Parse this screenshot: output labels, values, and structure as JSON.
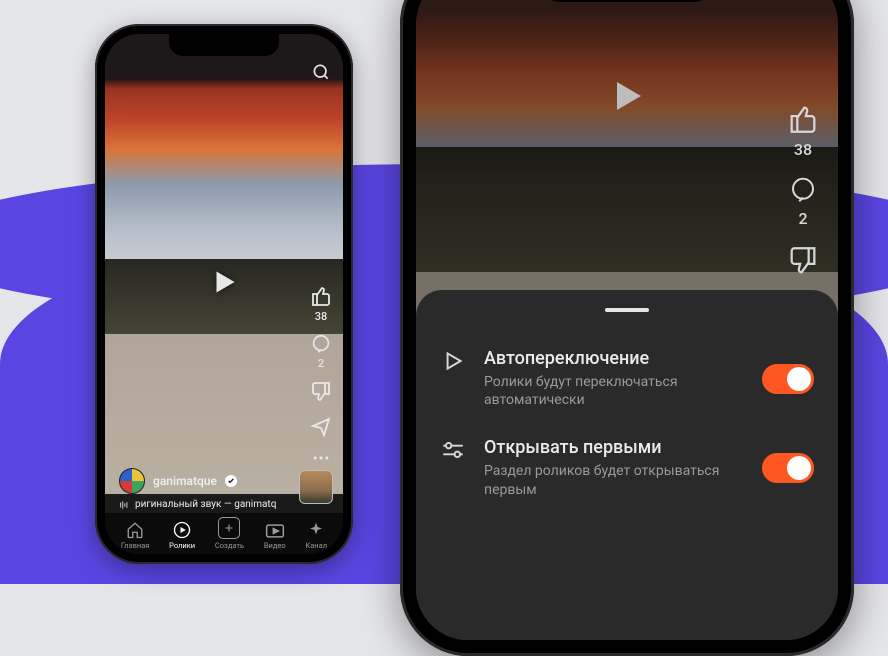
{
  "phone1": {
    "author_name": "ganimatque",
    "audio_text": "ригинальный звук — ganimatq",
    "likes": "38",
    "comments": "2",
    "tabs": {
      "home": "Главная",
      "clips": "Ролики",
      "create": "Создать",
      "video": "Видео",
      "channel": "Канал"
    }
  },
  "phone2": {
    "likes": "38",
    "comments": "2",
    "settings": {
      "autoplay": {
        "title": "Автопереключение",
        "desc": "Ролики будут переключаться автоматически",
        "on": true
      },
      "open_first": {
        "title": "Открывать первыми",
        "desc": "Раздел роликов будет открываться первым",
        "on": true
      }
    }
  },
  "colors": {
    "accent": "#ff5722",
    "purple": "#5946e2"
  }
}
